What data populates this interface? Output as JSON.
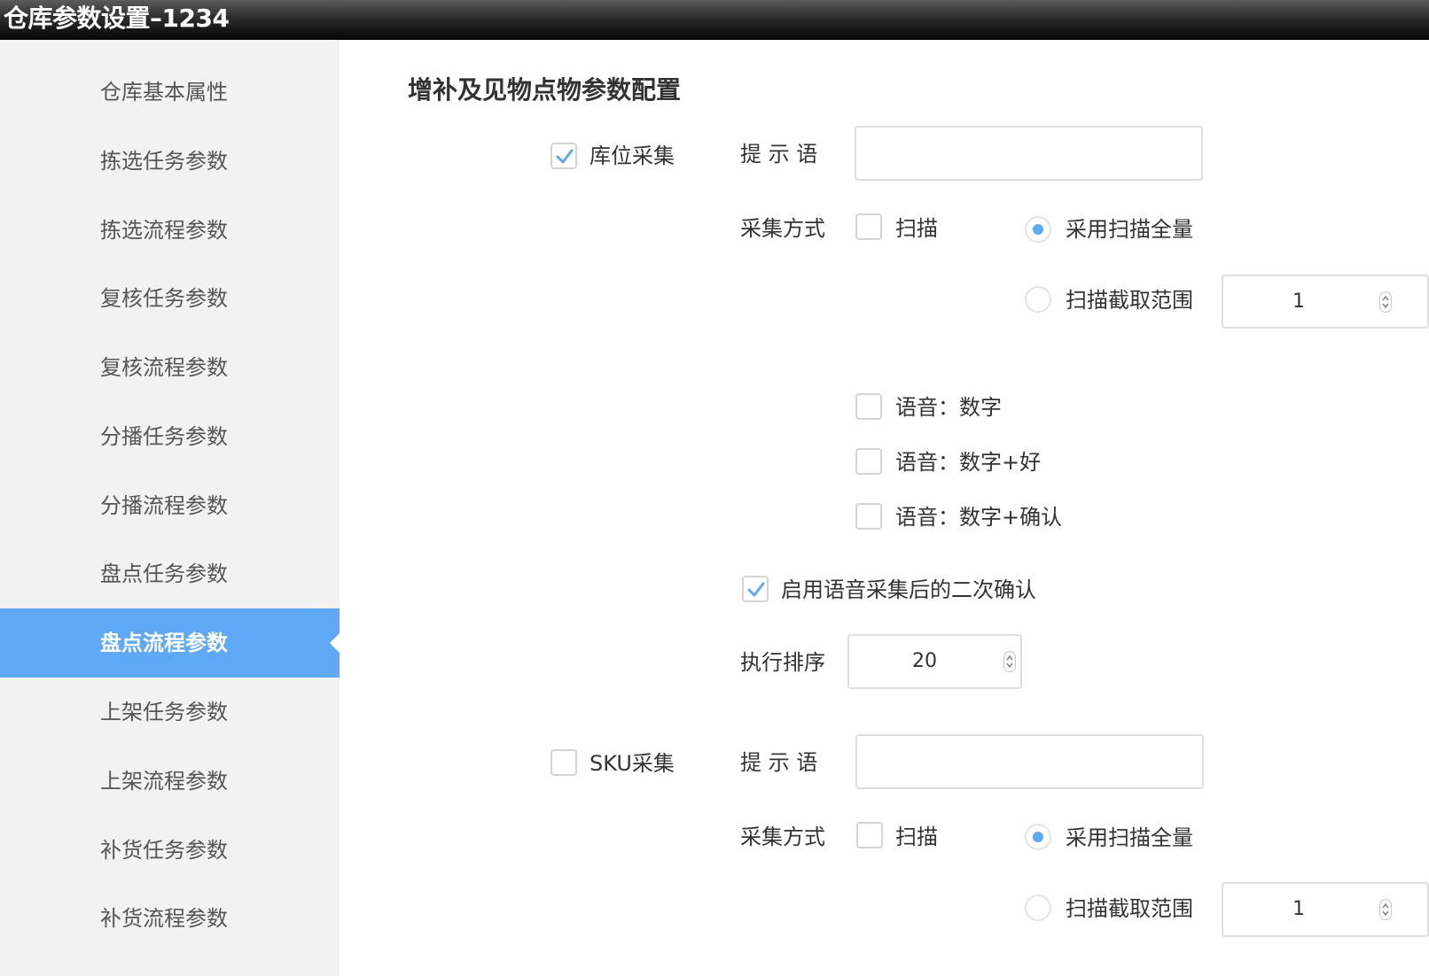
{
  "window": {
    "title": "仓库参数设置–1234"
  },
  "sidebar": {
    "items": [
      {
        "label": "仓库基本属性"
      },
      {
        "label": "拣选任务参数"
      },
      {
        "label": "拣选流程参数"
      },
      {
        "label": "复核任务参数"
      },
      {
        "label": "复核流程参数"
      },
      {
        "label": "分播任务参数"
      },
      {
        "label": "分播流程参数"
      },
      {
        "label": "盘点任务参数"
      },
      {
        "label": "盘点流程参数"
      },
      {
        "label": "上架任务参数"
      },
      {
        "label": "上架流程参数"
      },
      {
        "label": "补货任务参数"
      },
      {
        "label": "补货流程参数"
      }
    ],
    "active_index": 8,
    "accent_color": "#5ea8f6"
  },
  "main": {
    "section_title": "增补及见物点物参数配置",
    "location": {
      "toggle_label": "库位采集",
      "toggle_checked": true,
      "prompt_label": "提 示 语",
      "prompt_value": "",
      "method_label": "采集方式",
      "scan_label": "扫描",
      "scan_checked": false,
      "radio_full_label": "采用扫描全量",
      "radio_full_selected": true,
      "radio_range_label": "扫描截取范围",
      "radio_range_selected": false,
      "range_value": "1",
      "voice_options": [
        {
          "label": "语音：数字",
          "checked": false
        },
        {
          "label": "语音：数字+好",
          "checked": false
        },
        {
          "label": "语音：数字+确认",
          "checked": false
        }
      ],
      "second_confirm_label": "启用语音采集后的二次确认",
      "second_confirm_checked": true,
      "order_label": "执行排序",
      "order_value": "20"
    },
    "sku": {
      "toggle_label": "SKU采集",
      "toggle_checked": false,
      "prompt_label": "提 示 语",
      "prompt_value": "",
      "method_label": "采集方式",
      "scan_label": "扫描",
      "scan_checked": false,
      "radio_full_label": "采用扫描全量",
      "radio_full_selected": true,
      "radio_range_label": "扫描截取范围",
      "radio_range_selected": false,
      "range_value": "1"
    }
  }
}
